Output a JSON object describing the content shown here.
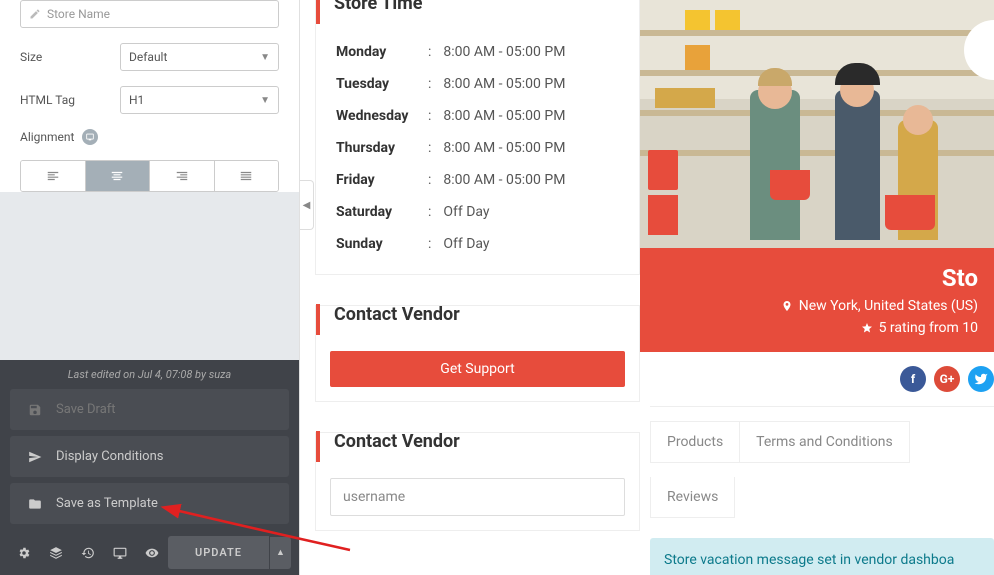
{
  "sidebar": {
    "storeNamePlaceholder": "Store Name",
    "sizeLabel": "Size",
    "sizeValue": "Default",
    "htmlTagLabel": "HTML Tag",
    "htmlTagValue": "H1",
    "alignLabel": "Alignment"
  },
  "footer": {
    "lastEdit": "Last edited on Jul 4, 07:08 by suza",
    "saveDraft": "Save Draft",
    "displayConditions": "Display Conditions",
    "saveTemplate": "Save as Template",
    "update": "UPDATE"
  },
  "store": {
    "timeHeader": "Store Time",
    "hours": [
      {
        "day": "Monday",
        "time": "8:00 AM - 05:00 PM"
      },
      {
        "day": "Tuesday",
        "time": "8:00 AM - 05:00 PM"
      },
      {
        "day": "Wednesday",
        "time": "8:00 AM - 05:00 PM"
      },
      {
        "day": "Thursday",
        "time": "8:00 AM - 05:00 PM"
      },
      {
        "day": "Friday",
        "time": "8:00 AM - 05:00 PM"
      },
      {
        "day": "Saturday",
        "time": "Off Day"
      },
      {
        "day": "Sunday",
        "time": "Off Day"
      }
    ],
    "contactHeader": "Contact Vendor",
    "getSupport": "Get Support",
    "username": "username"
  },
  "banner": {
    "name": "Sto",
    "location": "New York, United States (US)",
    "rating": "5 rating from 10"
  },
  "tabs": {
    "products": "Products",
    "terms": "Terms and Conditions",
    "reviews": "Reviews"
  },
  "vacation": "Store vacation message set in vendor dashboa"
}
